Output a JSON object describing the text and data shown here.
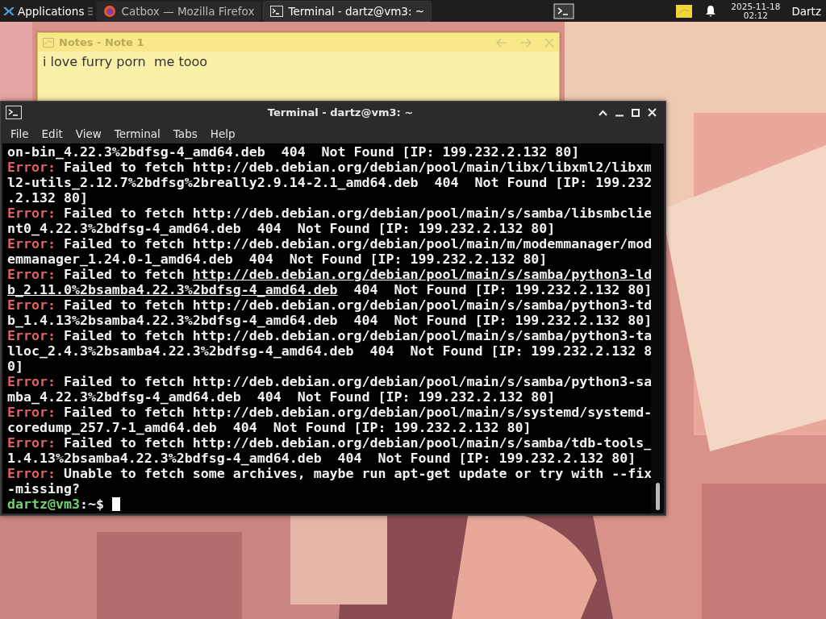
{
  "taskbar": {
    "applications_label": "Applications",
    "tasks": [
      {
        "title": "Catbox — Mozilla Firefox",
        "kind": "browser",
        "selected": false
      },
      {
        "title": "Terminal - dartz@vm3: ~",
        "kind": "terminal",
        "selected": true
      }
    ],
    "clock": {
      "date": "2025-11-18",
      "time": "02:12"
    },
    "user": "Dartz"
  },
  "notes": {
    "title": "Notes - Note 1",
    "text": "i love furry porn  me tooo"
  },
  "terminal": {
    "title": "Terminal - dartz@vm3: ~",
    "menu": [
      "File",
      "Edit",
      "View",
      "Terminal",
      "Tabs",
      "Help"
    ],
    "lines": [
      [
        {
          "kind": "plain",
          "text": "on-bin_4.22.3%2bdfsg-4_amd64.deb  404  Not Found [IP: 199.232.2.132 80]"
        }
      ],
      [
        {
          "kind": "error",
          "text": "Error:"
        },
        {
          "kind": "plain",
          "text": " Failed to fetch http://deb.debian.org/debian/pool/main/libx/libxml2/libxm"
        }
      ],
      [
        {
          "kind": "plain",
          "text": "l2-utils_2.12.7%2bdfsg%2breally2.9.14-2.1_amd64.deb  404  Not Found [IP: 199.232"
        }
      ],
      [
        {
          "kind": "plain",
          "text": ".2.132 80]"
        }
      ],
      [
        {
          "kind": "error",
          "text": "Error:"
        },
        {
          "kind": "plain",
          "text": " Failed to fetch http://deb.debian.org/debian/pool/main/s/samba/libsmbclie"
        }
      ],
      [
        {
          "kind": "plain",
          "text": "nt0_4.22.3%2bdfsg-4_amd64.deb  404  Not Found [IP: 199.232.2.132 80]"
        }
      ],
      [
        {
          "kind": "error",
          "text": "Error:"
        },
        {
          "kind": "plain",
          "text": " Failed to fetch http://deb.debian.org/debian/pool/main/m/modemmanager/mod"
        }
      ],
      [
        {
          "kind": "plain",
          "text": "emmanager_1.24.0-1_amd64.deb  404  Not Found [IP: 199.232.2.132 80]"
        }
      ],
      [
        {
          "kind": "error",
          "text": "Error:"
        },
        {
          "kind": "plain",
          "text": " Failed to fetch "
        },
        {
          "kind": "link",
          "text": "http://deb.debian.org/debian/pool/main/s/samba/python3-ld"
        }
      ],
      [
        {
          "kind": "link",
          "text": "b_2.11.0%2bsamba4.22.3%2bdfsg-4_amd64.deb"
        },
        {
          "kind": "plain",
          "text": "  404  Not Found [IP: 199.232.2.132 80]"
        }
      ],
      [
        {
          "kind": "error",
          "text": "Error:"
        },
        {
          "kind": "plain",
          "text": " Failed to fetch http://deb.debian.org/debian/pool/main/s/samba/python3-td"
        }
      ],
      [
        {
          "kind": "plain",
          "text": "b_1.4.13%2bsamba4.22.3%2bdfsg-4_amd64.deb  404  Not Found [IP: 199.232.2.132 80]"
        }
      ],
      [
        {
          "kind": "error",
          "text": "Error:"
        },
        {
          "kind": "plain",
          "text": " Failed to fetch http://deb.debian.org/debian/pool/main/s/samba/python3-ta"
        }
      ],
      [
        {
          "kind": "plain",
          "text": "lloc_2.4.3%2bsamba4.22.3%2bdfsg-4_amd64.deb  404  Not Found [IP: 199.232.2.132 8"
        }
      ],
      [
        {
          "kind": "plain",
          "text": "0]"
        }
      ],
      [
        {
          "kind": "error",
          "text": "Error:"
        },
        {
          "kind": "plain",
          "text": " Failed to fetch http://deb.debian.org/debian/pool/main/s/samba/python3-sa"
        }
      ],
      [
        {
          "kind": "plain",
          "text": "mba_4.22.3%2bdfsg-4_amd64.deb  404  Not Found [IP: 199.232.2.132 80]"
        }
      ],
      [
        {
          "kind": "error",
          "text": "Error:"
        },
        {
          "kind": "plain",
          "text": " Failed to fetch http://deb.debian.org/debian/pool/main/s/systemd/systemd-"
        }
      ],
      [
        {
          "kind": "plain",
          "text": "coredump_257.7-1_amd64.deb  404  Not Found [IP: 199.232.2.132 80]"
        }
      ],
      [
        {
          "kind": "error",
          "text": "Error:"
        },
        {
          "kind": "plain",
          "text": " Failed to fetch http://deb.debian.org/debian/pool/main/s/samba/tdb-tools_"
        }
      ],
      [
        {
          "kind": "plain",
          "text": "1.4.13%2bsamba4.22.3%2bdfsg-4_amd64.deb  404  Not Found [IP: 199.232.2.132 80]"
        }
      ],
      [
        {
          "kind": "error",
          "text": "Error:"
        },
        {
          "kind": "plain",
          "text": " Unable to fetch some archives, maybe run apt-get update or try with --fix"
        }
      ],
      [
        {
          "kind": "plain",
          "text": "-missing?"
        }
      ]
    ],
    "prompt": {
      "user_host": "dartz@vm3",
      "path": ":~$"
    }
  }
}
